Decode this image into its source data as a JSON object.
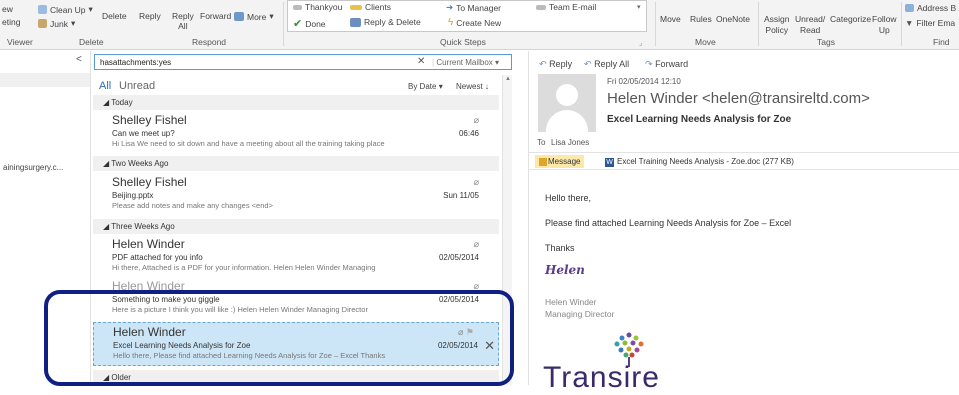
{
  "ribbon": {
    "left_new": "ew",
    "left_meeting": "eting",
    "clean_up": "Clean Up",
    "junk": "Junk",
    "delete": "Delete",
    "reply": "Reply",
    "reply_all_1": "Reply",
    "reply_all_2": "All",
    "forward": "Forward",
    "more": "More",
    "qs_thankyou": "Thankyou",
    "qs_done": "Done",
    "qs_clients": "Clients",
    "qs_reply_delete": "Reply & Delete",
    "qs_to_manager": "To Manager",
    "qs_create_new": "Create New",
    "qs_team_email": "Team E-mail",
    "move": "Move",
    "rules": "Rules",
    "onenote": "OneNote",
    "assign_1": "Assign",
    "assign_2": "Policy",
    "unread_1": "Unread/",
    "unread_2": "Read",
    "categorize": "Categorize",
    "follow_1": "Follow",
    "follow_2": "Up",
    "address_book": "Address B",
    "filter_email": "Filter Ema",
    "groups": {
      "viewer": "Viewer",
      "delete": "Delete",
      "respond": "Respond",
      "quick_steps": "Quick Steps",
      "move": "Move",
      "tags": "Tags",
      "find": "Find"
    }
  },
  "folders": {
    "collapse": "<",
    "item": "ainingsurgery.c..."
  },
  "list": {
    "search_text": "hasattachments:yes",
    "search_scope": "Current Mailbox",
    "filter_all": "All",
    "filter_unread": "Unread",
    "sort_by": "By Date",
    "sort_order": "Newest",
    "groups": [
      "Today",
      "Two Weeks Ago",
      "Three Weeks Ago",
      "Older"
    ],
    "messages": [
      {
        "from": "Shelley Fishel",
        "subject": "Can we meet up?",
        "preview": "Hi Lisa  We need to sit down and have a meeting about all the training taking place",
        "date": "06:46"
      },
      {
        "from": "Shelley Fishel",
        "subject": "Beijing.pptx",
        "preview": "Please add notes and make any changes <end>",
        "date": "Sun 11/05"
      },
      {
        "from": "Helen Winder",
        "subject": "PDF attached for you info",
        "preview": "Hi there,  Attached is a PDF for your information.  Helen  Helen Winder  Managing",
        "date": "02/05/2014"
      },
      {
        "from": "Helen Winder",
        "subject": "Something to make you giggle",
        "preview": "Here is a picture I think you will like :)  Helen  Helen Winder  Managing Director",
        "date": "02/05/2014"
      },
      {
        "from": "Helen Winder",
        "subject": "Excel Learning Needs Analysis for Zoe",
        "preview": "Hello there,  Please find attached Learning Needs Analysis for Zoe – Excel  Thanks",
        "date": "02/05/2014"
      }
    ]
  },
  "reading": {
    "reply": "Reply",
    "reply_all": "Reply All",
    "forward": "Forward",
    "date": "Fri 02/05/2014 12:10",
    "from": "Helen Winder <helen@transireltd.com>",
    "subject": "Excel Learning Needs Analysis for Zoe",
    "to_label": "To",
    "to": "Lisa Jones",
    "att_message": "Message",
    "att_file": "Excel Training Needs Analysis - Zoe.doc (277 KB)",
    "body": [
      "Hello there,",
      "Please find attached Learning Needs Analysis for Zoe – Excel",
      "Thanks"
    ],
    "sig_name": "Helen",
    "sig_title_1": "Helen Winder",
    "sig_title_2": "Managing Director",
    "logo_text": "Transire"
  },
  "colors": {
    "accent_blue": "#2a6fb8",
    "selected_row": "#cde6f7",
    "highlight_outline": "#0f2080",
    "logo_purple": "#3b2a6b"
  }
}
